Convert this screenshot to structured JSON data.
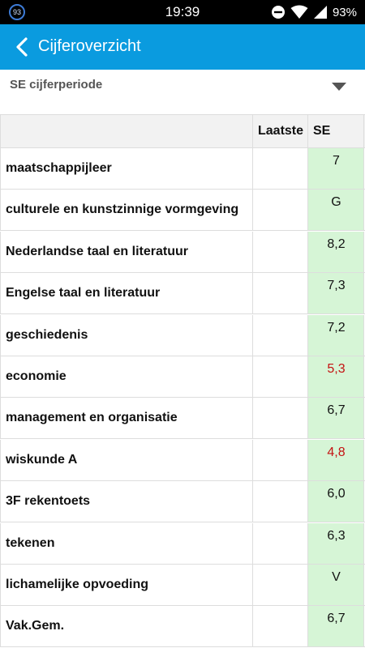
{
  "statusbar": {
    "badge": "93",
    "time": "19:39",
    "battery": "93%"
  },
  "header": {
    "title": "Cijferoverzicht"
  },
  "period": {
    "label": "SE cijferperiode"
  },
  "table": {
    "columns": [
      "",
      "Laatste",
      "SE"
    ],
    "rows": [
      {
        "subject": "maatschappijleer",
        "latest": "",
        "se": "7",
        "se_low": false
      },
      {
        "subject": "culturele en kunstzinnige vormgeving",
        "latest": "",
        "se": "G",
        "se_low": false
      },
      {
        "subject": "Nederlandse taal en literatuur",
        "latest": "",
        "se": "8,2",
        "se_low": false
      },
      {
        "subject": "Engelse taal en literatuur",
        "latest": "",
        "se": "7,3",
        "se_low": false
      },
      {
        "subject": "geschiedenis",
        "latest": "",
        "se": "7,2",
        "se_low": false
      },
      {
        "subject": "economie",
        "latest": "",
        "se": "5,3",
        "se_low": true
      },
      {
        "subject": "management en organisatie",
        "latest": "",
        "se": "6,7",
        "se_low": false
      },
      {
        "subject": "wiskunde A",
        "latest": "",
        "se": "4,8",
        "se_low": true
      },
      {
        "subject": "3F rekentoets",
        "latest": "",
        "se": "6,0",
        "se_low": false
      },
      {
        "subject": "tekenen",
        "latest": "",
        "se": "6,3",
        "se_low": false
      },
      {
        "subject": "lichamelijke opvoeding",
        "latest": "",
        "se": "V",
        "se_low": false
      },
      {
        "subject": "Vak.Gem.",
        "latest": "",
        "se": "6,7",
        "se_low": false
      }
    ]
  },
  "colors": {
    "appbar": "#0a9bdf",
    "grade_bg": "#d6f5d6",
    "low_grade": "#c41212"
  }
}
